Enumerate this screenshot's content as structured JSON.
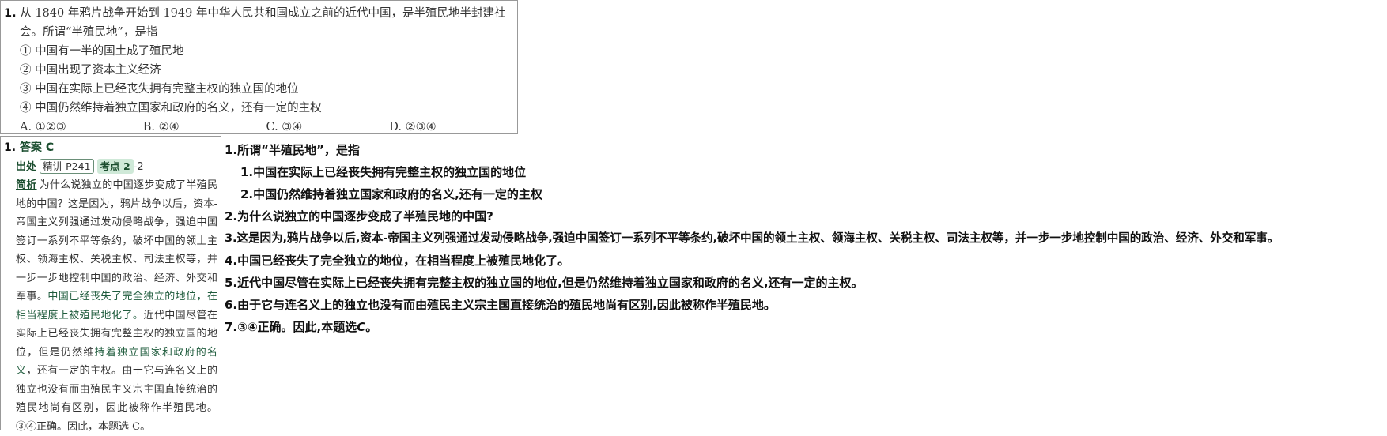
{
  "question": {
    "number": "1.",
    "stem_line1": "从 1840 年鸦片战争开始到 1949 年中华人民共和国成立之前的近代中国，是半殖民地半封建社",
    "stem_line2": "会。所谓“半殖民地”，是指",
    "options": [
      "① 中国有一半的国土成了殖民地",
      "② 中国出现了资本主义经济",
      "③ 中国在实际上已经丧失拥有完整主权的独立国的地位",
      "④ 中国仍然维持着独立国家和政府的名义，还有一定的主权"
    ],
    "choices": [
      "A. ①②③",
      "B. ②④",
      "C. ③④",
      "D. ②③④"
    ]
  },
  "answer": {
    "number": "1.",
    "label": "答案",
    "value": "C",
    "source_label": "出处",
    "source_tag": "精讲 P241",
    "point_tag": "考点 2",
    "point_suffix": "-2",
    "analysis_label": "简析",
    "analysis_text_1": "为什么说独立的中国逐步变成了半殖民地的中国？这是因为，鸦片战争以后，资本-帝国主义列强通过发动侵略战争，强迫中国签订一系列不平等条约，破坏中国的领土主权、领海主权、关税主权、司法主权等，并一步一步地控制中国的政治、经济、外交和军事。",
    "analysis_text_2": "中国已经丧失了完全独立的地位，在相当程度上被殖民地化了。",
    "analysis_text_3": "近代中国尽管在实际上已经丧失拥有完整主权的独立国的地位，但是仍然维",
    "analysis_text_4": "持着独立国家和政府的名义",
    "analysis_text_5": "，还有一定的主权。由于它与连名义上的独立也没有而由殖民主义宗主国直接统治的殖民地尚有区别，因此被称作半殖民地。③④正确。因此，本题选 C。"
  },
  "notes": {
    "line1": "1.所谓“半殖民地”，是指",
    "sub1": "1.中国在实际上已经丧失拥有完整主权的独立国的地位",
    "sub2": "2.中国仍然维持着独立国家和政府的名义,还有一定的主权",
    "line2": "2.为什么说独立的中国逐步变成了半殖民地的中国?",
    "line3": "3.这是因为,鸦片战争以后,资本-帝国主义列强通过发动侵略战争,强迫中国签订一系列不平等条约,破坏中国的领土主权、领海主权、关税主权、司法主权等，并一步一步地控制中国的政治、经济、外交和军事。",
    "line4": "4.中国已经丧失了完全独立的地位，在相当程度上被殖民地化了。",
    "line5": "5.近代中国尽管在实际上已经丧失拥有完整主权的独立国的地位,但是仍然维持着独立国家和政府的名义,还有一定的主权。",
    "line6": "6.由于它与连名义上的独立也没有而由殖民主义宗主国直接统治的殖民地尚有区别,因此被称作半殖民地。",
    "line7_text": "7.③④正确。因此,本题选",
    "line7_answer": "C",
    "line7_end": "。"
  }
}
